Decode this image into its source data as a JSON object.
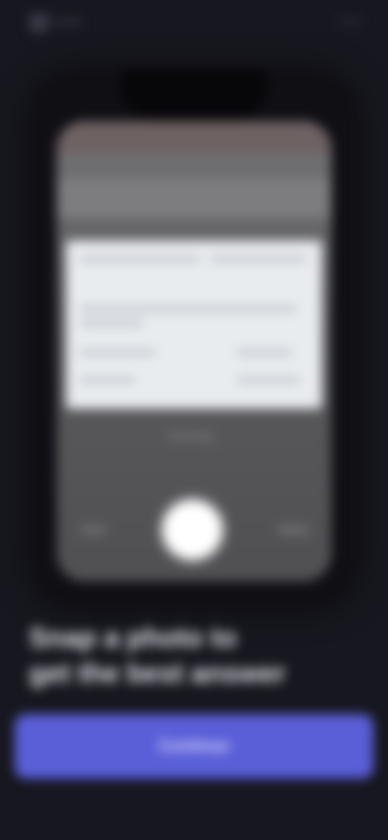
{
  "header": {
    "app_name": "Lens",
    "top_action_label": "Skip"
  },
  "phone_screen": {
    "caption": "Scanning...",
    "left_control": "Flash",
    "right_control": "Gallery"
  },
  "headline": {
    "line1": "Snap a photo to",
    "line2": "get the best answer"
  },
  "cta": {
    "label": "Continue"
  },
  "colors": {
    "background": "#17171f",
    "accent": "#5a5fd8"
  }
}
